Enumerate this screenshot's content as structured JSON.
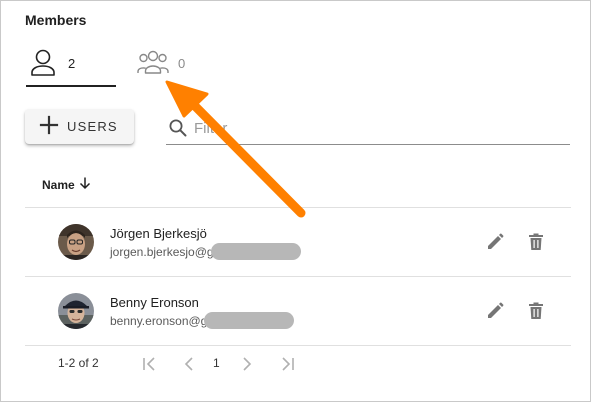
{
  "panel": {
    "title": "Members"
  },
  "tabs": [
    {
      "name": "users",
      "icon": "person-icon",
      "count": "2",
      "active": true
    },
    {
      "name": "groups",
      "icon": "group-icon",
      "count": "0",
      "active": false
    }
  ],
  "toolbar": {
    "add_users_label": "USERS",
    "add_icon": "plus-icon"
  },
  "filter": {
    "placeholder": "Filter",
    "value": ""
  },
  "table": {
    "columns": [
      {
        "label": "Name",
        "sort": "descending",
        "sort_icon": "arrow-down-icon"
      }
    ],
    "rows": [
      {
        "name": "Jörgen Bjerkesjö",
        "email_visible": "jorgen.bjerkesjo@g",
        "email_redacted": true
      },
      {
        "name": "Benny Eronson",
        "email_visible": "benny.eronson@g",
        "email_redacted": true
      }
    ]
  },
  "pagination": {
    "range": "1-2 of 2",
    "current_page": "1"
  },
  "colors": {
    "annotation_arrow": "#ff8000",
    "active_tab_indicator": "#212121",
    "icon_gray": "#757575"
  }
}
